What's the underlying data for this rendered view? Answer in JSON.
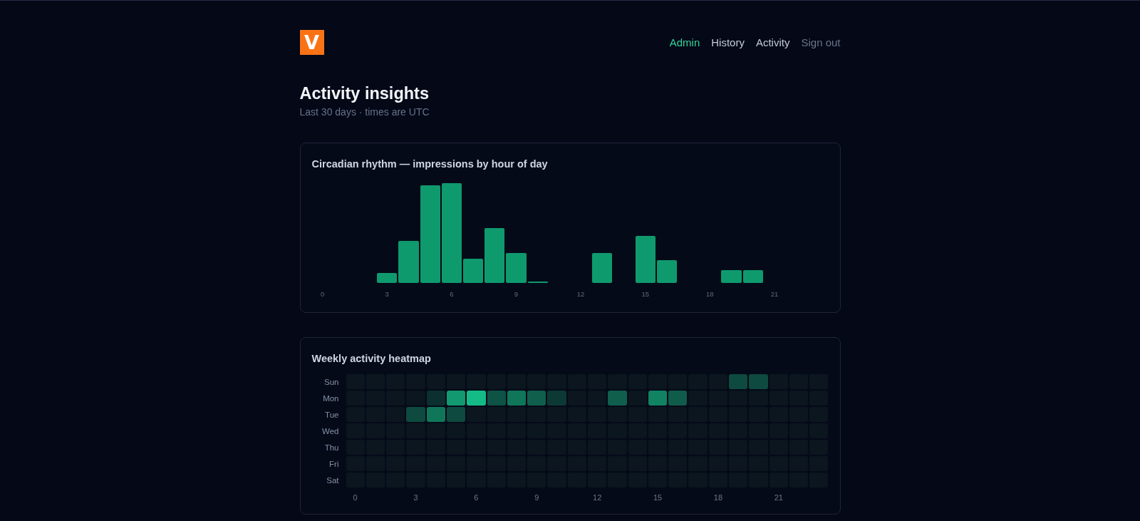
{
  "header": {
    "logo": {
      "text": "V"
    },
    "nav": [
      {
        "label": "Admin",
        "selected": true,
        "kind": "link"
      },
      {
        "label": "History",
        "selected": false,
        "kind": "link"
      },
      {
        "label": "Activity",
        "selected": false,
        "kind": "link"
      },
      {
        "label": "Sign out",
        "selected": false,
        "kind": "action"
      }
    ]
  },
  "page": {
    "title": "Activity insights",
    "subtitle": "Last 30 days · times are UTC"
  },
  "hourly_card": {
    "title": "Circadian rhythm — impressions by hour of day",
    "xticks": [
      "0",
      "3",
      "6",
      "9",
      "12",
      "15",
      "18",
      "21"
    ]
  },
  "heatmap_card": {
    "title": "Weekly activity heatmap",
    "rows": [
      "Sun",
      "Mon",
      "Tue",
      "Wed",
      "Thu",
      "Fri",
      "Sat"
    ],
    "xticks": [
      "0",
      "3",
      "6",
      "9",
      "12",
      "15",
      "18",
      "21"
    ]
  }
}
